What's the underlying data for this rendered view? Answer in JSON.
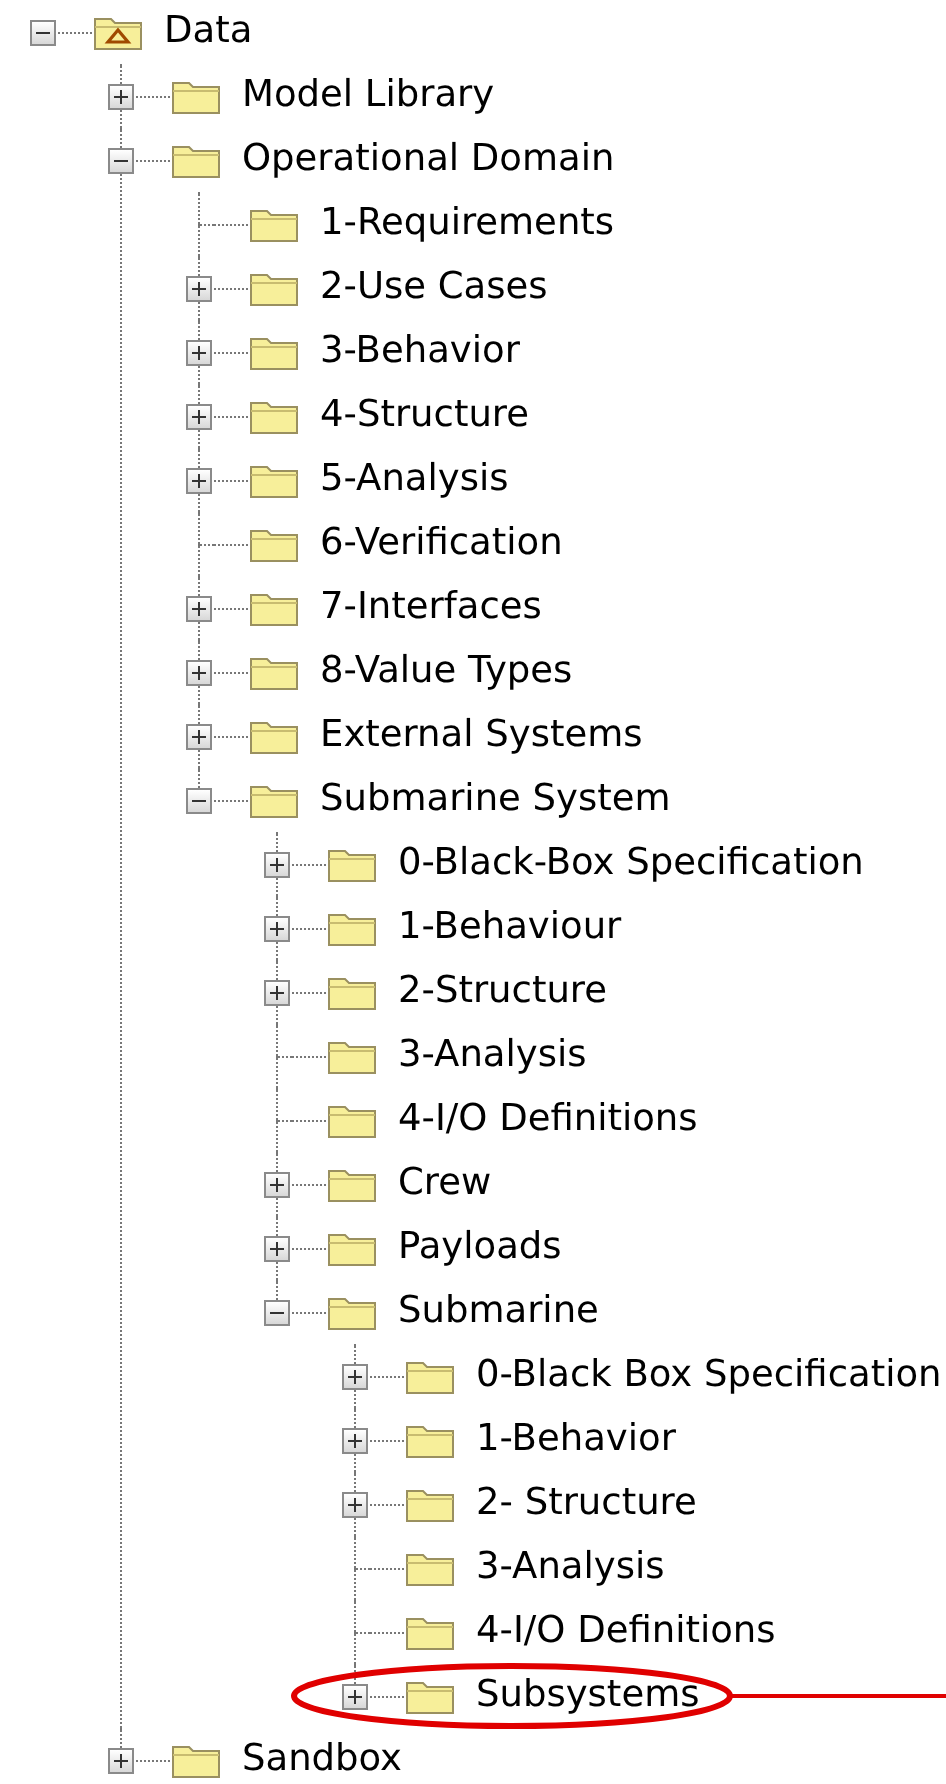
{
  "tree": [
    {
      "label": "Data",
      "kind": "package",
      "expanded": true,
      "children": [
        {
          "label": "Model Library",
          "kind": "folder",
          "expanded": false
        },
        {
          "label": "Operational Domain",
          "kind": "folder",
          "expanded": true,
          "children": [
            {
              "label": "1-Requirements",
              "kind": "folder"
            },
            {
              "label": "2-Use Cases",
              "kind": "folder",
              "expanded": false
            },
            {
              "label": "3-Behavior",
              "kind": "folder",
              "expanded": false
            },
            {
              "label": "4-Structure",
              "kind": "folder",
              "expanded": false
            },
            {
              "label": "5-Analysis",
              "kind": "folder",
              "expanded": false
            },
            {
              "label": "6-Verification",
              "kind": "folder"
            },
            {
              "label": "7-Interfaces",
              "kind": "folder",
              "expanded": false
            },
            {
              "label": "8-Value Types",
              "kind": "folder",
              "expanded": false
            },
            {
              "label": "External Systems",
              "kind": "folder",
              "expanded": false
            },
            {
              "label": "Submarine System",
              "kind": "folder",
              "expanded": true,
              "children": [
                {
                  "label": "0-Black-Box Specification",
                  "kind": "folder",
                  "expanded": false
                },
                {
                  "label": "1-Behaviour",
                  "kind": "folder",
                  "expanded": false
                },
                {
                  "label": "2-Structure",
                  "kind": "folder",
                  "expanded": false
                },
                {
                  "label": "3-Analysis",
                  "kind": "folder"
                },
                {
                  "label": "4-I/O Definitions",
                  "kind": "folder"
                },
                {
                  "label": "Crew",
                  "kind": "folder",
                  "expanded": false
                },
                {
                  "label": "Payloads",
                  "kind": "folder",
                  "expanded": false
                },
                {
                  "label": "Submarine",
                  "kind": "folder",
                  "expanded": true,
                  "children": [
                    {
                      "label": "0-Black Box Specification",
                      "kind": "folder",
                      "expanded": false,
                      "highlighted": false
                    },
                    {
                      "label": "1-Behavior",
                      "kind": "folder",
                      "expanded": false,
                      "highlighted": false
                    },
                    {
                      "label": "2- Structure",
                      "kind": "folder",
                      "expanded": false,
                      "highlighted": false
                    },
                    {
                      "label": "3-Analysis",
                      "kind": "folder",
                      "highlighted": false
                    },
                    {
                      "label": "4-I/O Definitions",
                      "kind": "folder",
                      "highlighted": false
                    },
                    {
                      "label": "Subsystems",
                      "kind": "folder",
                      "expanded": false,
                      "highlighted": true
                    }
                  ]
                }
              ]
            }
          ]
        },
        {
          "label": "Sandbox",
          "kind": "folder",
          "expanded": false
        }
      ]
    }
  ]
}
